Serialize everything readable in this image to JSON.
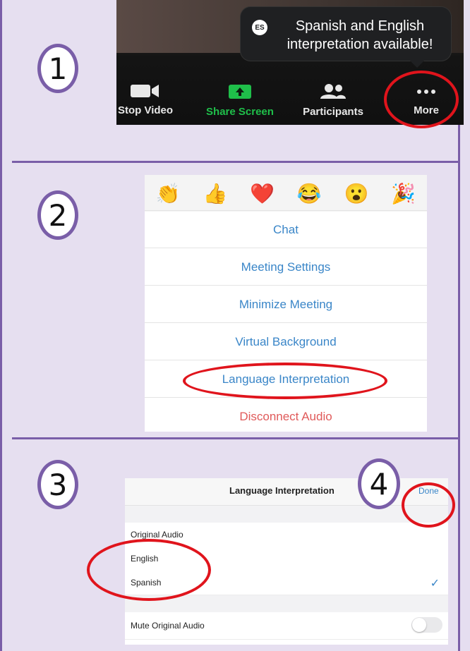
{
  "steps": {
    "s1": "1",
    "s2": "2",
    "s3": "3",
    "s4": "4"
  },
  "toolbar": {
    "tooltip_badge": "ES",
    "tooltip_text": "Spanish and English interpretation available!",
    "stop_video": "Stop Video",
    "share_screen": "Share Screen",
    "participants": "Participants",
    "more": "More",
    "share_color": "#1fbf4a"
  },
  "menu": {
    "reactions": [
      "👏",
      "👍",
      "❤️",
      "😂",
      "😮",
      "🎉"
    ],
    "items": [
      {
        "label": "Chat"
      },
      {
        "label": "Meeting Settings"
      },
      {
        "label": "Minimize Meeting"
      },
      {
        "label": "Virtual Background"
      },
      {
        "label": "Language Interpretation"
      },
      {
        "label": "Disconnect Audio"
      }
    ],
    "disconnect_color": "#e05a5a"
  },
  "interpretation": {
    "title": "Language Interpretation",
    "done": "Done",
    "options": [
      "Original Audio",
      "English",
      "Spanish"
    ],
    "selected": "Spanish",
    "mute_label": "Mute Original Audio",
    "mute_on": false
  },
  "colors": {
    "accent": "#3a86c8",
    "highlight": "#e0141c",
    "frame": "#7a5ea8"
  }
}
